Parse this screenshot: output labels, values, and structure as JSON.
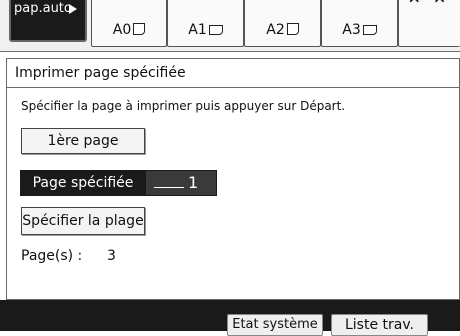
{
  "top_strip": {
    "paper_auto_label": "pap.auto",
    "trays": [
      {
        "label": "A0",
        "icon": "paper-portrait-icon"
      },
      {
        "label": "A1",
        "icon": "paper-landscape-icon"
      },
      {
        "label": "A2",
        "icon": "paper-portrait-icon"
      },
      {
        "label": "A3",
        "icon": "paper-landscape-icon"
      }
    ],
    "more_glyph": "⌃ ⌃"
  },
  "dialog": {
    "title": "Imprimer page spécifiée",
    "instruction": "Spécifier la page à imprimer puis appuyer sur Départ.",
    "first_page_button": "1ère page",
    "specified_page_button": "Page spécifiée",
    "specified_page_value": "1",
    "specify_range_button": "Spécifier la plage",
    "pages_label": "Page(s) :",
    "pages_value": "3"
  },
  "bottom_bar": {
    "system_status_button": "Etat système",
    "job_list_button": "Liste trav."
  },
  "colors": {
    "selected_button": "#1a1a1a",
    "bottom_bar": "#1a1a1a"
  }
}
